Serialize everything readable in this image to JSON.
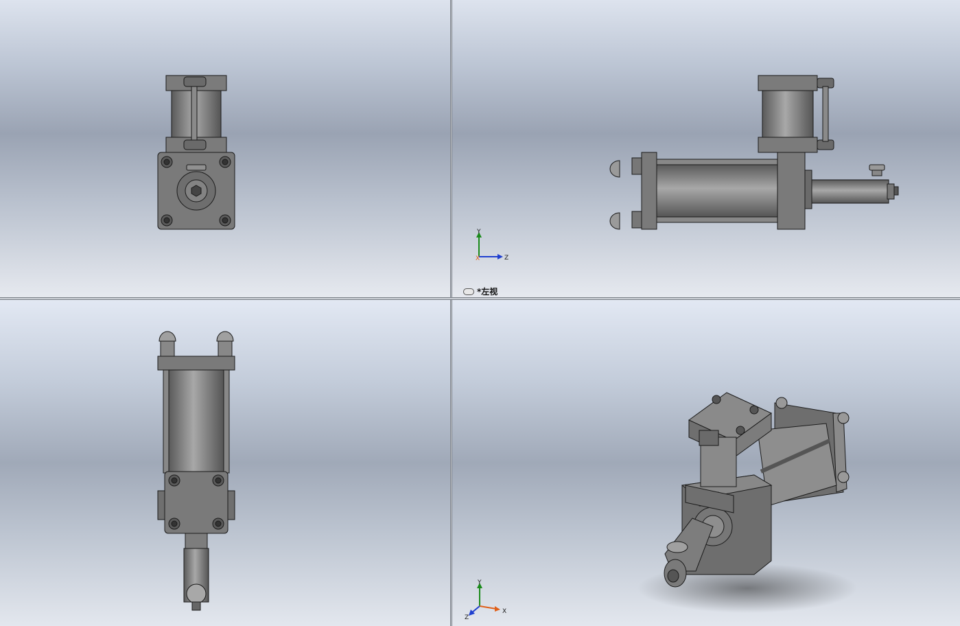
{
  "viewports": {
    "top_right": {
      "view_name": "*左视",
      "axis_labels": {
        "y": "Y",
        "z": "Z",
        "x": "X"
      }
    },
    "bottom_right": {
      "axis_labels": {
        "y": "Y",
        "z": "Z",
        "x": "X"
      }
    }
  },
  "colors": {
    "axis_y": "#1a8a1a",
    "axis_z": "#1f3fd0",
    "axis_x": "#e0601a",
    "part_body": "#7f7f7f",
    "part_edge": "#1a1a1a"
  }
}
